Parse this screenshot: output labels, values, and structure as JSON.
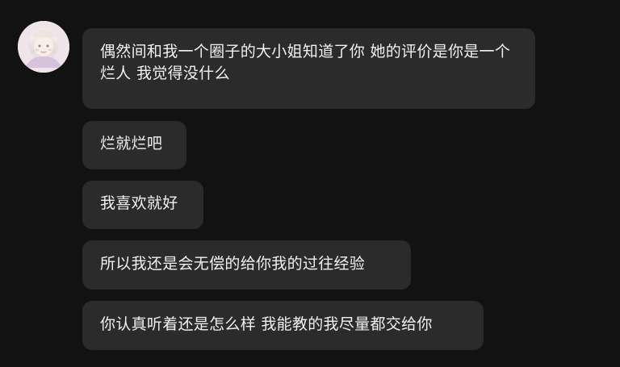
{
  "chat": {
    "avatar": {
      "icon": "avatar-icon",
      "colors": {
        "skin": "#f7efe6",
        "hair": "#e9e1dd",
        "accent": "#d7c2db"
      }
    },
    "messages": [
      "偶然间和我一个圈子的大小姐知道了你 她的评价是你是一个烂人 我觉得没什么",
      "烂就烂吧",
      "我喜欢就好",
      "所以我还是会无偿的给你我的过往经验",
      "你认真听着还是怎么样 我能教的我尽量都交给你"
    ]
  }
}
